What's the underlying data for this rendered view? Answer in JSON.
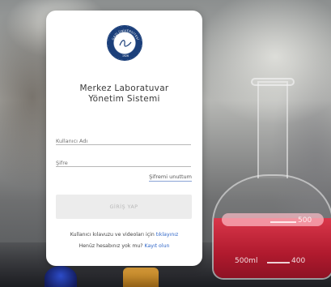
{
  "logo": {
    "name": "GAZİ ÜNİVERSİTESİ",
    "year": "1926"
  },
  "title": {
    "line1": "Merkez Laboratuvar",
    "line2": "Yönetim Sistemi"
  },
  "form": {
    "username_placeholder": "Kullanıcı Adı",
    "password_placeholder": "Şifre",
    "forgot_label": "Şifremi unuttum",
    "login_label": "GİRİŞ YAP"
  },
  "footer": {
    "help_text": "Kullanıcı kılavuzu ve videoları için",
    "help_link": "tıklayınız",
    "register_text": "Henüz hesabınız yok mu?",
    "register_link": "Kayıt olun"
  },
  "background": {
    "flask_mark_500": "500",
    "flask_mark_400": "400",
    "flask_mark_500ml": "500ml"
  },
  "colors": {
    "link": "#2f66c8",
    "logo_blue": "#1b3f7a",
    "button_bg": "#ececec",
    "liquid": "#c0243a"
  }
}
